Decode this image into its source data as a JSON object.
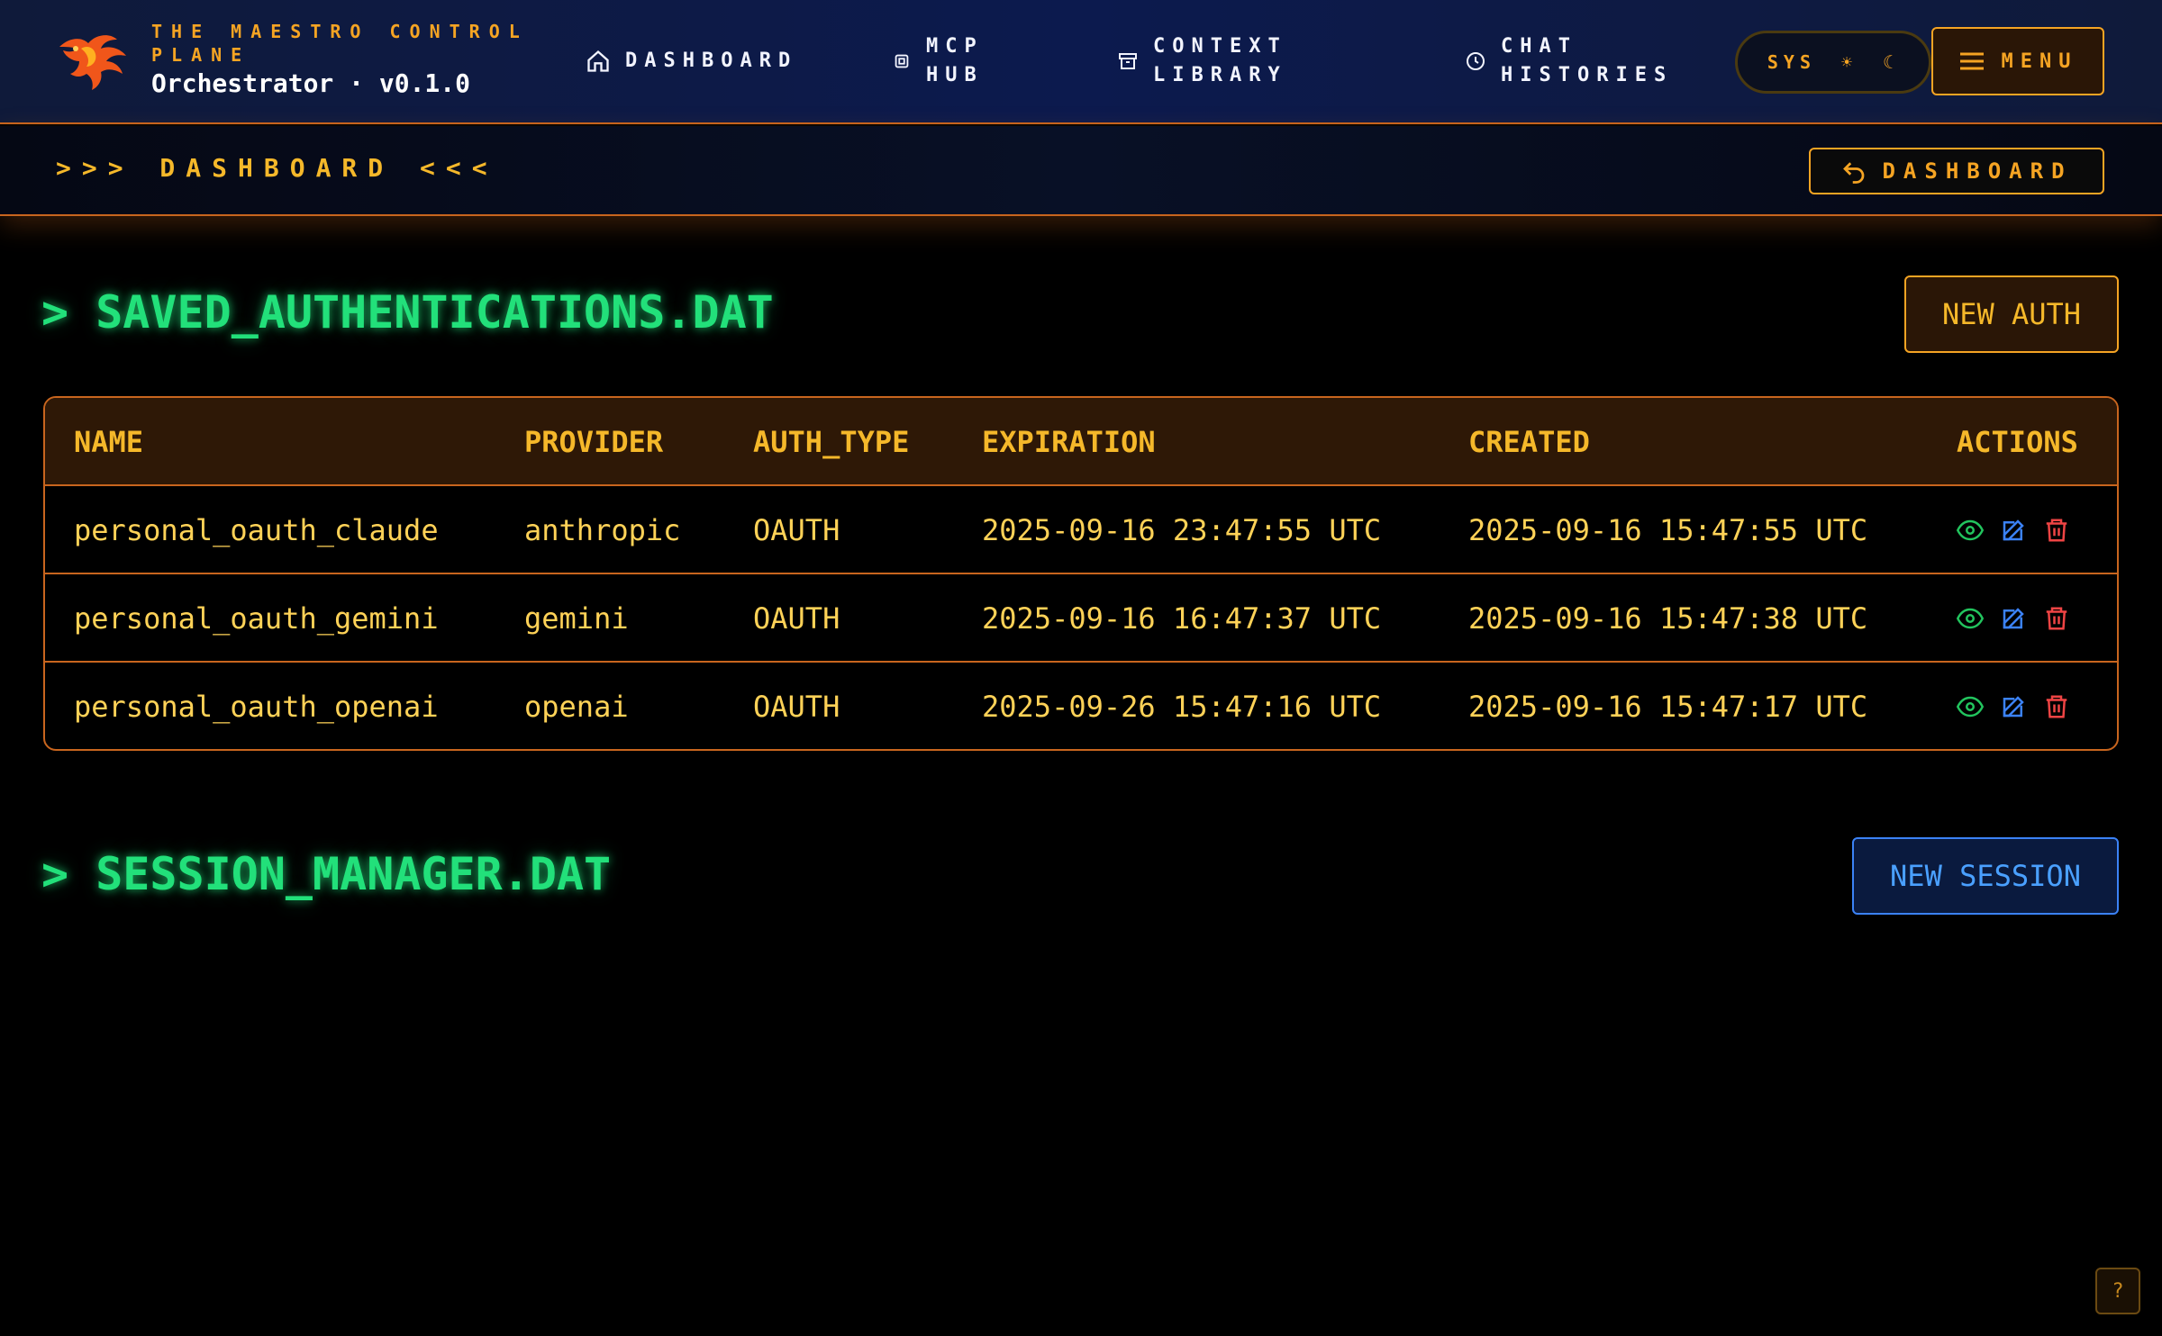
{
  "header": {
    "brand_subtitle": "THE MAESTRO CONTROL PLANE",
    "brand_title": "Orchestrator · v0.1.0",
    "logo_icon": "phoenix-logo",
    "nav": [
      {
        "label": "DASHBOARD",
        "icon": "home-icon"
      },
      {
        "label": "MCP HUB",
        "icon": "chip-icon"
      },
      {
        "label": "CONTEXT LIBRARY",
        "icon": "archive-icon"
      },
      {
        "label": "CHAT HISTORIES",
        "icon": "clock-icon"
      }
    ],
    "theme_toggle": {
      "label": "SYS",
      "sun": "☀",
      "moon": "☾"
    },
    "menu_label": "MENU"
  },
  "subheader": {
    "title": ">>> DASHBOARD <<<",
    "back_button_label": "DASHBOARD"
  },
  "auth_section": {
    "title": "> SAVED_AUTHENTICATIONS.DAT",
    "new_button_label": "NEW AUTH",
    "columns": [
      "NAME",
      "PROVIDER",
      "AUTH_TYPE",
      "EXPIRATION",
      "CREATED",
      "ACTIONS"
    ],
    "rows": [
      {
        "name": "personal_oauth_claude",
        "provider": "anthropic",
        "auth_type": "OAUTH",
        "expiration": "2025-09-16 23:47:55 UTC",
        "created": "2025-09-16 15:47:55 UTC"
      },
      {
        "name": "personal_oauth_gemini",
        "provider": "gemini",
        "auth_type": "OAUTH",
        "expiration": "2025-09-16 16:47:37 UTC",
        "created": "2025-09-16 15:47:38 UTC"
      },
      {
        "name": "personal_oauth_openai",
        "provider": "openai",
        "auth_type": "OAUTH",
        "expiration": "2025-09-26 15:47:16 UTC",
        "created": "2025-09-16 15:47:17 UTC"
      }
    ],
    "row_actions": [
      {
        "icon": "eye-icon",
        "color": "#22c55e"
      },
      {
        "icon": "edit-icon",
        "color": "#3b82f6"
      },
      {
        "icon": "trash-icon",
        "color": "#ef4444"
      }
    ]
  },
  "session_section": {
    "title": "> SESSION_MANAGER.DAT",
    "new_button_label": "NEW SESSION"
  },
  "help_label": "?",
  "colors": {
    "accent_orange": "#f5a423",
    "terminal_green": "#22e07a",
    "text_yellow": "#ffd257",
    "session_blue": "#3b82f6"
  }
}
